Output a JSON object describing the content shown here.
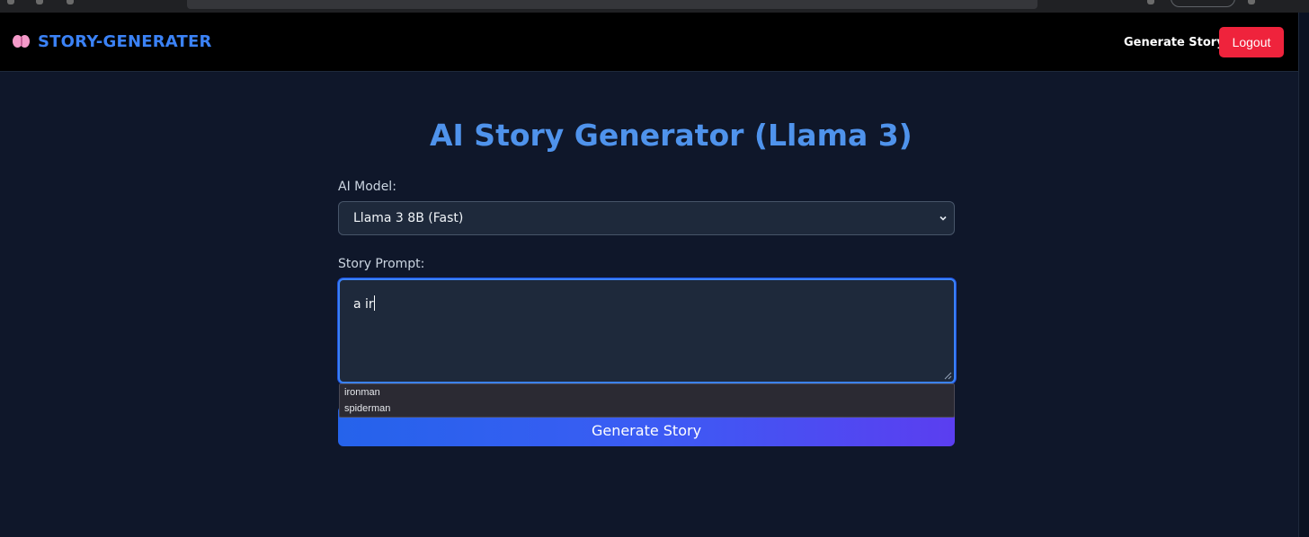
{
  "navbar": {
    "brand": "STORY-GENERATER",
    "brand_icon": "brain-icon",
    "links": [
      {
        "label": "Generate Story"
      }
    ],
    "logout_label": "Logout"
  },
  "page": {
    "title": "AI Story Generator (Llama 3)",
    "title_icon": "sparkles-icon"
  },
  "form": {
    "model_label": "AI Model:",
    "model_selected": "Llama 3 8B (Fast)",
    "prompt_label": "Story Prompt:",
    "prompt_value": "a ir",
    "autocomplete": [
      "ironman",
      "spiderman"
    ],
    "submit_label": "Generate Story"
  },
  "colors": {
    "background": "#0f172a",
    "navbar": "#000000",
    "brand": "#3b82f6",
    "title": "#4f93ec",
    "logout": "#ef233c",
    "button_gradient_start": "#2563eb",
    "button_gradient_end": "#5b3ef0"
  }
}
